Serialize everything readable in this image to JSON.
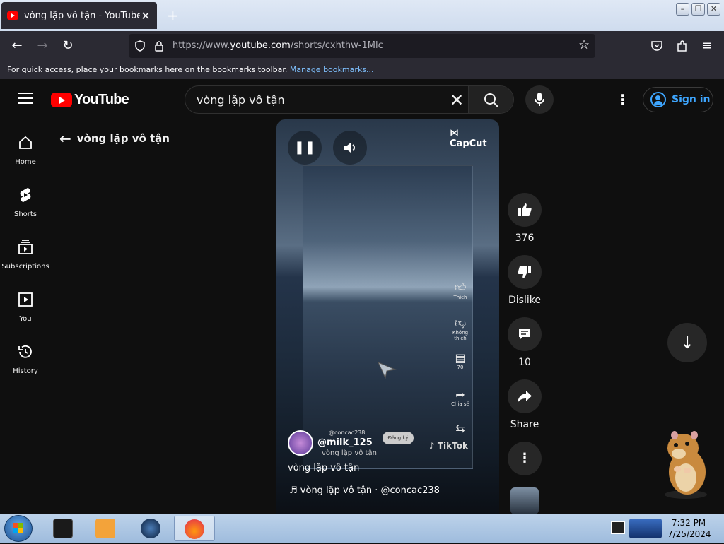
{
  "browser": {
    "tab_title": "vòng lặp vô tận - YouTube",
    "url_prefix": "https://www.",
    "url_domain": "youtube.com",
    "url_path": "/shorts/cxhthw-1Mlc",
    "bookmarks_text": "For quick access, place your bookmarks here on the bookmarks toolbar.",
    "bookmarks_link": "Manage bookmarks..."
  },
  "youtube": {
    "logo_text": "YouTube",
    "search_query": "vòng lặp vô tận",
    "sign_in": "Sign in"
  },
  "sidebar": {
    "items": [
      {
        "label": "Home",
        "icon": "home-icon"
      },
      {
        "label": "Shorts",
        "icon": "shorts-icon"
      },
      {
        "label": "Subscriptions",
        "icon": "subscriptions-icon"
      },
      {
        "label": "You",
        "icon": "you-icon"
      },
      {
        "label": "History",
        "icon": "history-icon"
      }
    ]
  },
  "page": {
    "back_title": "vòng lặp vô tận"
  },
  "video": {
    "watermark": "CapCut",
    "overlay_like": "Thích",
    "overlay_dislike": "Không thích",
    "overlay_comments": "70",
    "overlay_share": "Chia sẻ",
    "overlay_tiktok": "TikTok",
    "overlay_username": "@concac238",
    "overlay_subscribe": "Đăng ký",
    "channel_handle": "@milk_125",
    "channel_sub": "vòng lặp vô tận",
    "title": "vòng lặp vô tận",
    "music": "vòng lặp vô tận · @concac238"
  },
  "actions": {
    "likes": "376",
    "dislike": "Dislike",
    "comments": "10",
    "share": "Share"
  },
  "taskbar": {
    "time": "7:32 PM",
    "date": "7/25/2024"
  },
  "colors": {
    "yt_red": "#ff0000",
    "link_blue": "#3ea6ff",
    "bg": "#0f0f0f"
  }
}
